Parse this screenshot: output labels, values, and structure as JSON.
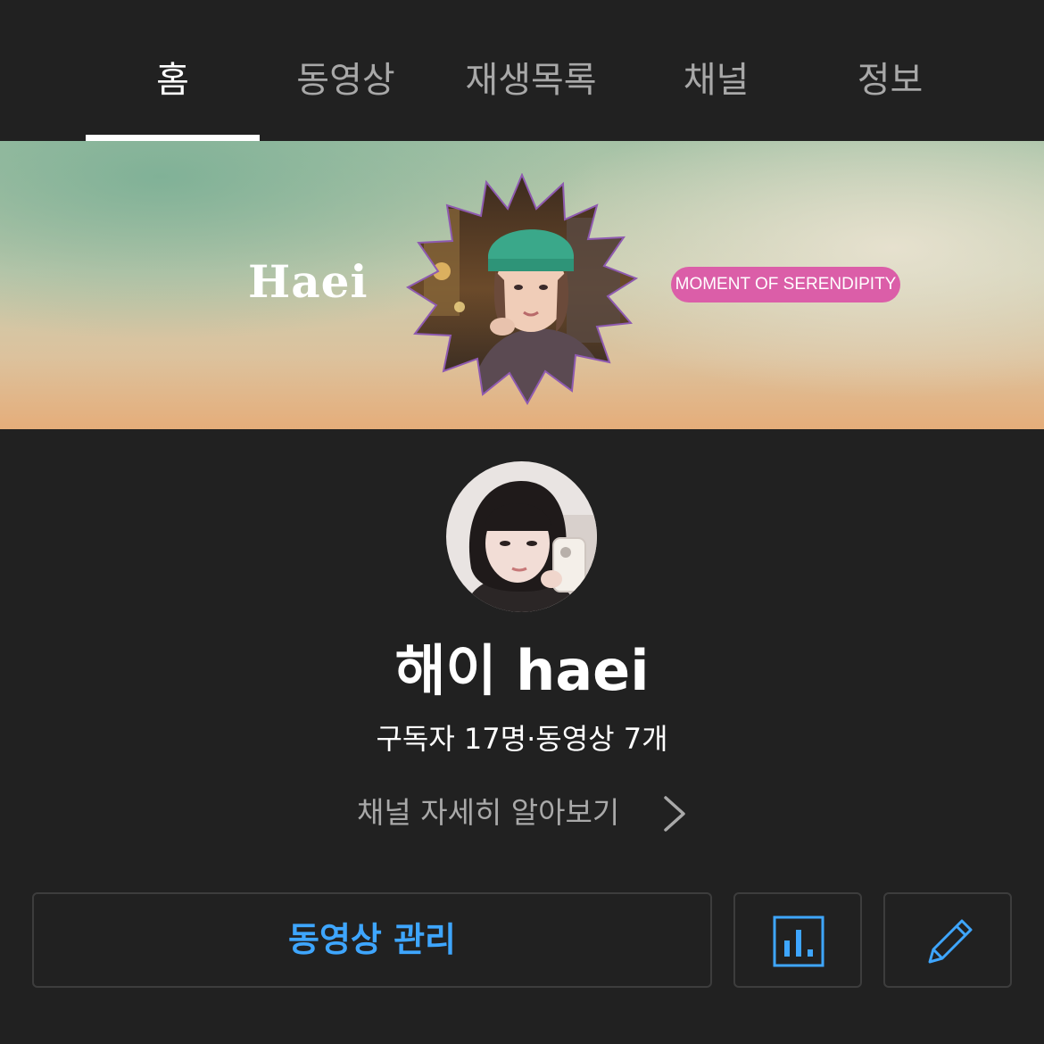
{
  "tabs": [
    {
      "label": "홈",
      "active": true
    },
    {
      "label": "동영상"
    },
    {
      "label": "재생목록"
    },
    {
      "label": "채널"
    },
    {
      "label": "정보"
    }
  ],
  "banner": {
    "title": "Haei",
    "badge": "MOMENT OF SERENDIPITY"
  },
  "channel": {
    "name": "해이 haei",
    "stats": "구독자 17명·동영상 7개",
    "more_label": "채널 자세히 알아보기"
  },
  "actions": {
    "manage_label": "동영상 관리",
    "stats_icon": "analytics-icon",
    "edit_icon": "pencil-icon"
  },
  "colors": {
    "background": "#212121",
    "accent_blue": "#3ea6ff",
    "badge_pink": "#db5ea8"
  }
}
